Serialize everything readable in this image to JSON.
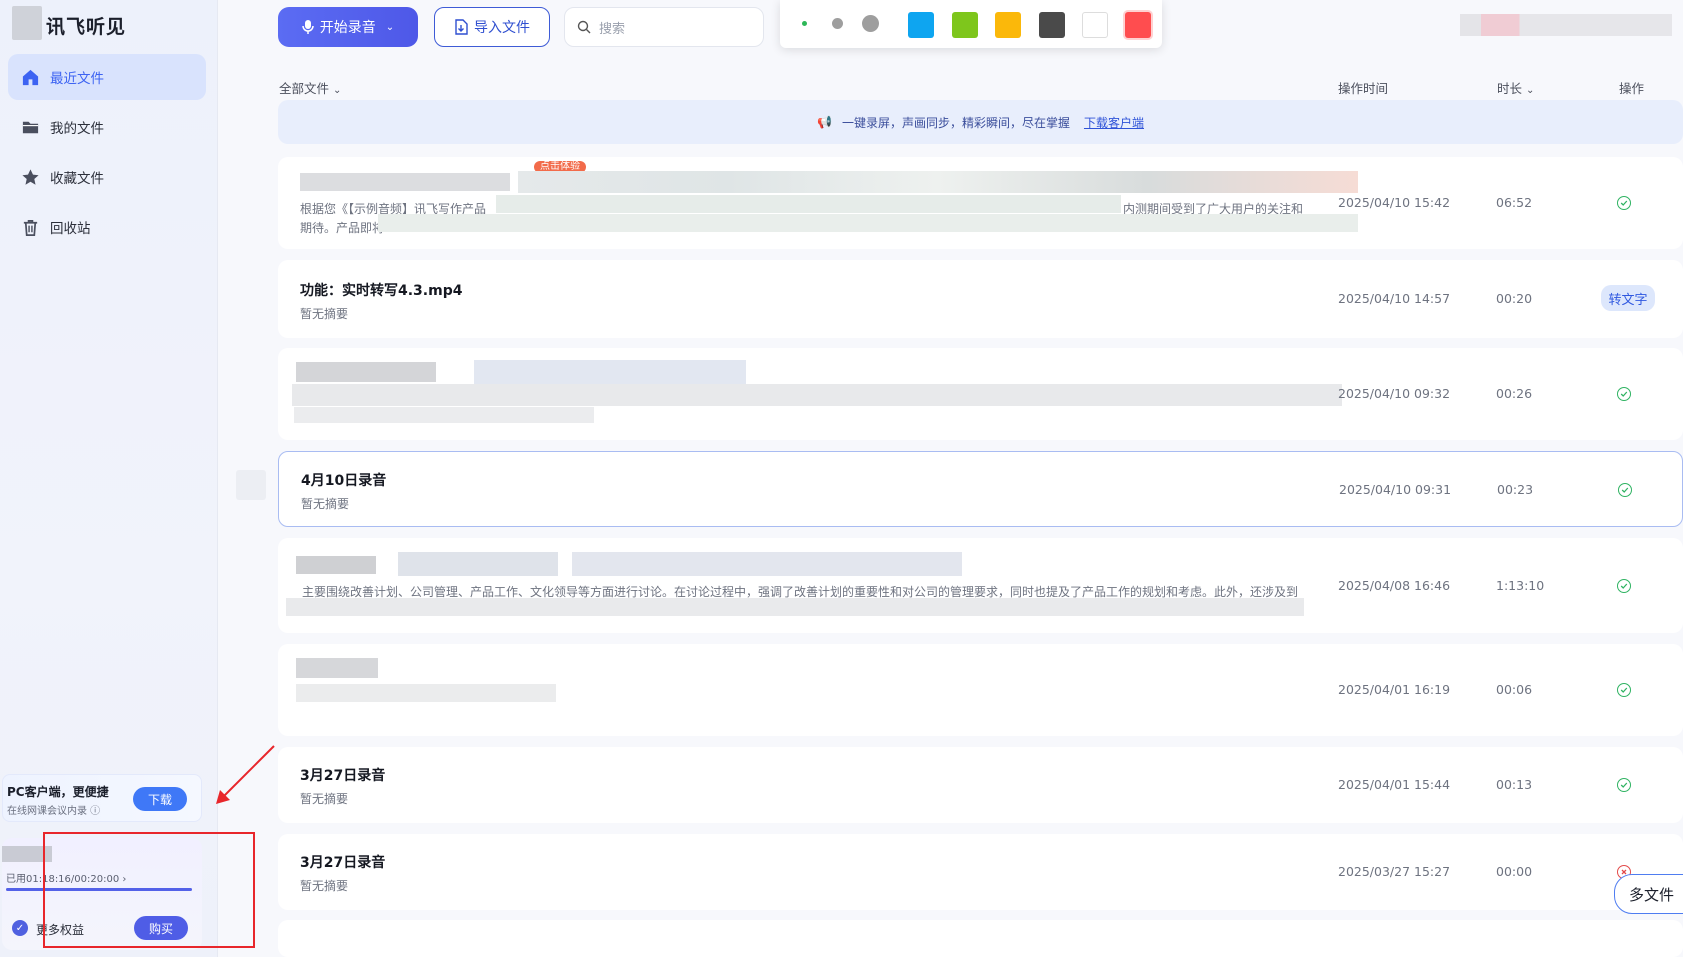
{
  "app": {
    "name": "讯飞听见"
  },
  "sidebar": {
    "items": [
      {
        "label": "最近文件",
        "icon": "home-icon",
        "active": true
      },
      {
        "label": "我的文件",
        "icon": "folder-icon",
        "active": false
      },
      {
        "label": "收藏文件",
        "icon": "star-icon",
        "active": false
      },
      {
        "label": "回收站",
        "icon": "trash-icon",
        "active": false
      }
    ],
    "promo": {
      "title": "PC客户端，更便捷",
      "subtitle": "在线网课会议内录 ⓘ",
      "button": "下载"
    },
    "usage": {
      "text": "已用01:18:16/00:20:00 ›",
      "progress": 1.0
    },
    "perks": {
      "label": "更多权益",
      "button": "购买"
    }
  },
  "toolbar": {
    "record_label": "开始录音",
    "import_label": "导入文件",
    "search_placeholder": "搜索"
  },
  "color_picker": {
    "swatches": [
      "#0ea5f0",
      "#7ec61c",
      "#fbb80a",
      "#4a4a4a",
      "#ffffff",
      "#ff4d4f"
    ],
    "dot_sizes": [
      "small",
      "medium",
      "large"
    ],
    "dot_colors": [
      "#2db757",
      "#9e9e9e",
      "#9e9e9e"
    ]
  },
  "table": {
    "headers": {
      "name": "全部文件",
      "time": "操作时间",
      "duration": "时长",
      "action": "操作"
    },
    "banner": {
      "text": "一键录屏，声画同步，精彩瞬间，尽在掌握",
      "link": "下载客户端"
    },
    "rows": [
      {
        "title": "",
        "summary": "根据您《【示例音频】讯飞写作产品",
        "summary_tail": "内测期间受到了广大用户的关注和",
        "summary2": "期待。产品即将",
        "badge": "点击体验",
        "time": "2025/04/10 15:42",
        "duration": "06:52",
        "status": "done"
      },
      {
        "title": "功能：实时转写4.3.mp4",
        "summary": "暂无摘要",
        "time": "2025/04/10 14:57",
        "duration": "00:20",
        "status": "button",
        "action": "转文字"
      },
      {
        "title": "",
        "summary": "",
        "time": "2025/04/10 09:32",
        "duration": "00:26",
        "status": "done"
      },
      {
        "title": "4月10日录音",
        "summary": "暂无摘要",
        "time": "2025/04/10 09:31",
        "duration": "00:23",
        "status": "done"
      },
      {
        "title": "",
        "summary": "主要围绕改善计划、公司管理、产品工作、文化领导等方面进行讨论。在讨论过程中，强调了改善计划的重要性和对公司的管理要求，同时也提及了产品工作的规划和考虑。此外，还涉及到",
        "time": "2025/04/08 16:46",
        "duration": "1:13:10",
        "status": "done"
      },
      {
        "title": "",
        "summary": "",
        "time": "2025/04/01 16:19",
        "duration": "00:06",
        "status": "done"
      },
      {
        "title": "3月27日录音",
        "summary": "暂无摘要",
        "time": "2025/04/01 15:44",
        "duration": "00:13",
        "status": "done"
      },
      {
        "title": "3月27日录音",
        "summary": "暂无摘要",
        "time": "2025/03/27 15:27",
        "duration": "00:00",
        "status": "error"
      }
    ]
  },
  "floating": {
    "label": "多文件"
  }
}
